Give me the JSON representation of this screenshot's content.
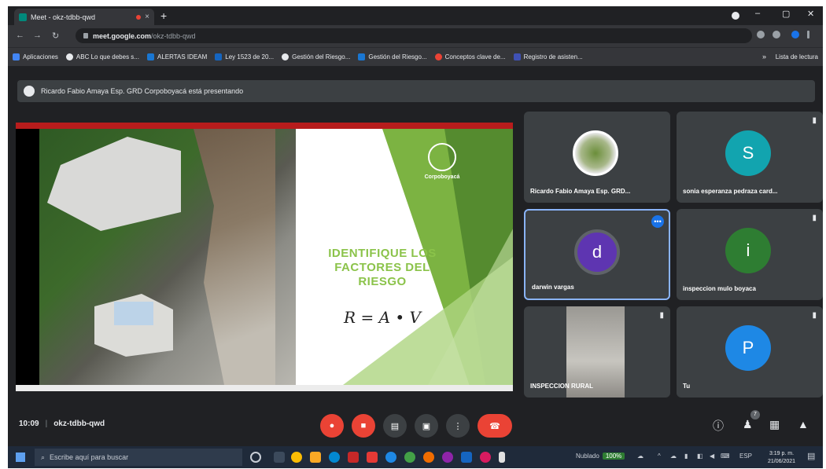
{
  "browser": {
    "tab_title": "Meet - okz-tdbb-qwd",
    "tab_close": "×",
    "new_tab": "+",
    "url_host": "meet.google.com",
    "url_path": "/okz-tdbb-qwd",
    "window_controls": {
      "minimize": "–",
      "maximize": "▢",
      "close": "✕"
    },
    "nav": {
      "back": "←",
      "forward": "→",
      "reload": "↻"
    }
  },
  "bookmarks": {
    "items": [
      {
        "label": "Aplicaciones",
        "color": "#4285f4"
      },
      {
        "label": "ABC Lo que debes s...",
        "color": "#e8eaed"
      },
      {
        "label": "ALERTAS IDEAM",
        "color": "#1976d2"
      },
      {
        "label": "Ley 1523 de 20...",
        "color": "#1565c0"
      },
      {
        "label": "Gestión del Riesgo...",
        "color": "#e8eaed"
      },
      {
        "label": "Gestión del Riesgo...",
        "color": "#1976d2"
      },
      {
        "label": "Conceptos clave de...",
        "color": "#ea4335"
      },
      {
        "label": "Registro de asisten...",
        "color": "#3f51b5"
      }
    ],
    "more": "»",
    "reading_list": "Lista de lectura"
  },
  "presenter": {
    "text": "Ricardo Fabio Amaya Esp. GRD Corpoboyacá está presentando"
  },
  "slide": {
    "org_name": "Corpoboyacá",
    "title": "IDENTIFIQUE LOS FACTORES DEL RIESGO",
    "formula": "R = A • V"
  },
  "participants": [
    {
      "name": "Ricardo Fabio Amaya Esp. GRD...",
      "initial": "",
      "color": "",
      "muted": false,
      "photo": true
    },
    {
      "name": "sonia esperanza pedraza card...",
      "initial": "S",
      "color": "#12a4af",
      "muted": true
    },
    {
      "name": "darwin vargas",
      "initial": "d",
      "color": "#5e35b1",
      "muted": false,
      "speaking": true
    },
    {
      "name": "inspeccion mulo boyaca",
      "initial": "i",
      "color": "#2e7d32",
      "muted": true
    },
    {
      "name": "INSPECCION RURAL",
      "initial": "",
      "color": "",
      "muted": true,
      "video": true
    },
    {
      "name": "Tu",
      "initial": "P",
      "color": "#1e88e5",
      "muted": true
    }
  ],
  "meetbar": {
    "time": "10:09",
    "separator": "|",
    "code": "okz-tdbb-qwd",
    "people_count": "7"
  },
  "taskbar": {
    "search_placeholder": "Escribe aquí para buscar",
    "weather": "Nublado",
    "volume": "100%",
    "lang": "ESP",
    "time": "3:19 p. m.",
    "date": "21/06/2021"
  }
}
